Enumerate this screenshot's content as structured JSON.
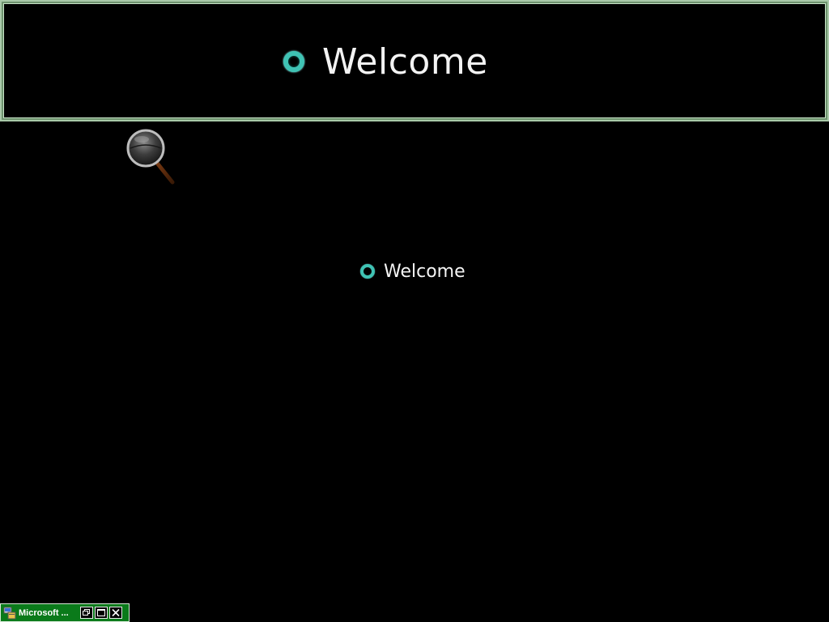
{
  "magnifier": {
    "welcome_text": "Welcome"
  },
  "main": {
    "welcome_text": "Welcome"
  },
  "minimized_window": {
    "title": "Microsoft ...",
    "buttons": {
      "restore": "restore-icon",
      "maximize": "maximize-icon",
      "close": "close-icon"
    }
  },
  "colors": {
    "background": "#000000",
    "accent_spinner": "#3fc3b4",
    "frame_green": "#a9c9a9",
    "titlebar_green": "#0a7a1a"
  }
}
